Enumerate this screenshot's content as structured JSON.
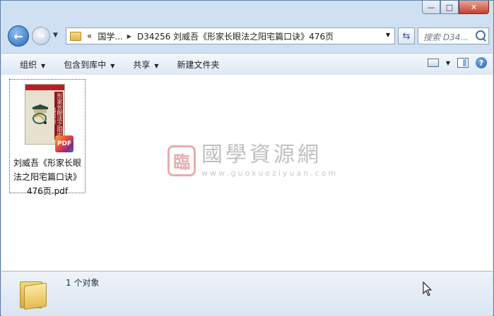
{
  "window": {
    "caption_buttons": {
      "minimize": "—",
      "maximize": "□",
      "close": "✕"
    }
  },
  "nav": {
    "back_icon": "back-arrow-icon",
    "forward_icon": "forward-arrow-icon",
    "breadcrumb_overflow": "«",
    "breadcrumb_root": "国学...",
    "breadcrumb_current": "D34256 刘威吾《形家长眼法之阳宅篇口诀》476页",
    "search_placeholder": "搜索 D34..."
  },
  "toolbar": {
    "organize": "组织",
    "include_in_library": "包含到库中",
    "share": "共享",
    "new_folder": "新建文件夹"
  },
  "content": {
    "file": {
      "name": "刘威吾《形家长眼法之阳宅篇口诀》476页.pdf",
      "badge": "PDF",
      "thumbnail_spine": "形家长眼法之阳宅篇口诀"
    },
    "watermark": {
      "logo_char": "臨",
      "main": "國學資源網",
      "sub": "www.guoxueziyuan.com"
    }
  },
  "status": {
    "count_text": "1 个对象"
  }
}
